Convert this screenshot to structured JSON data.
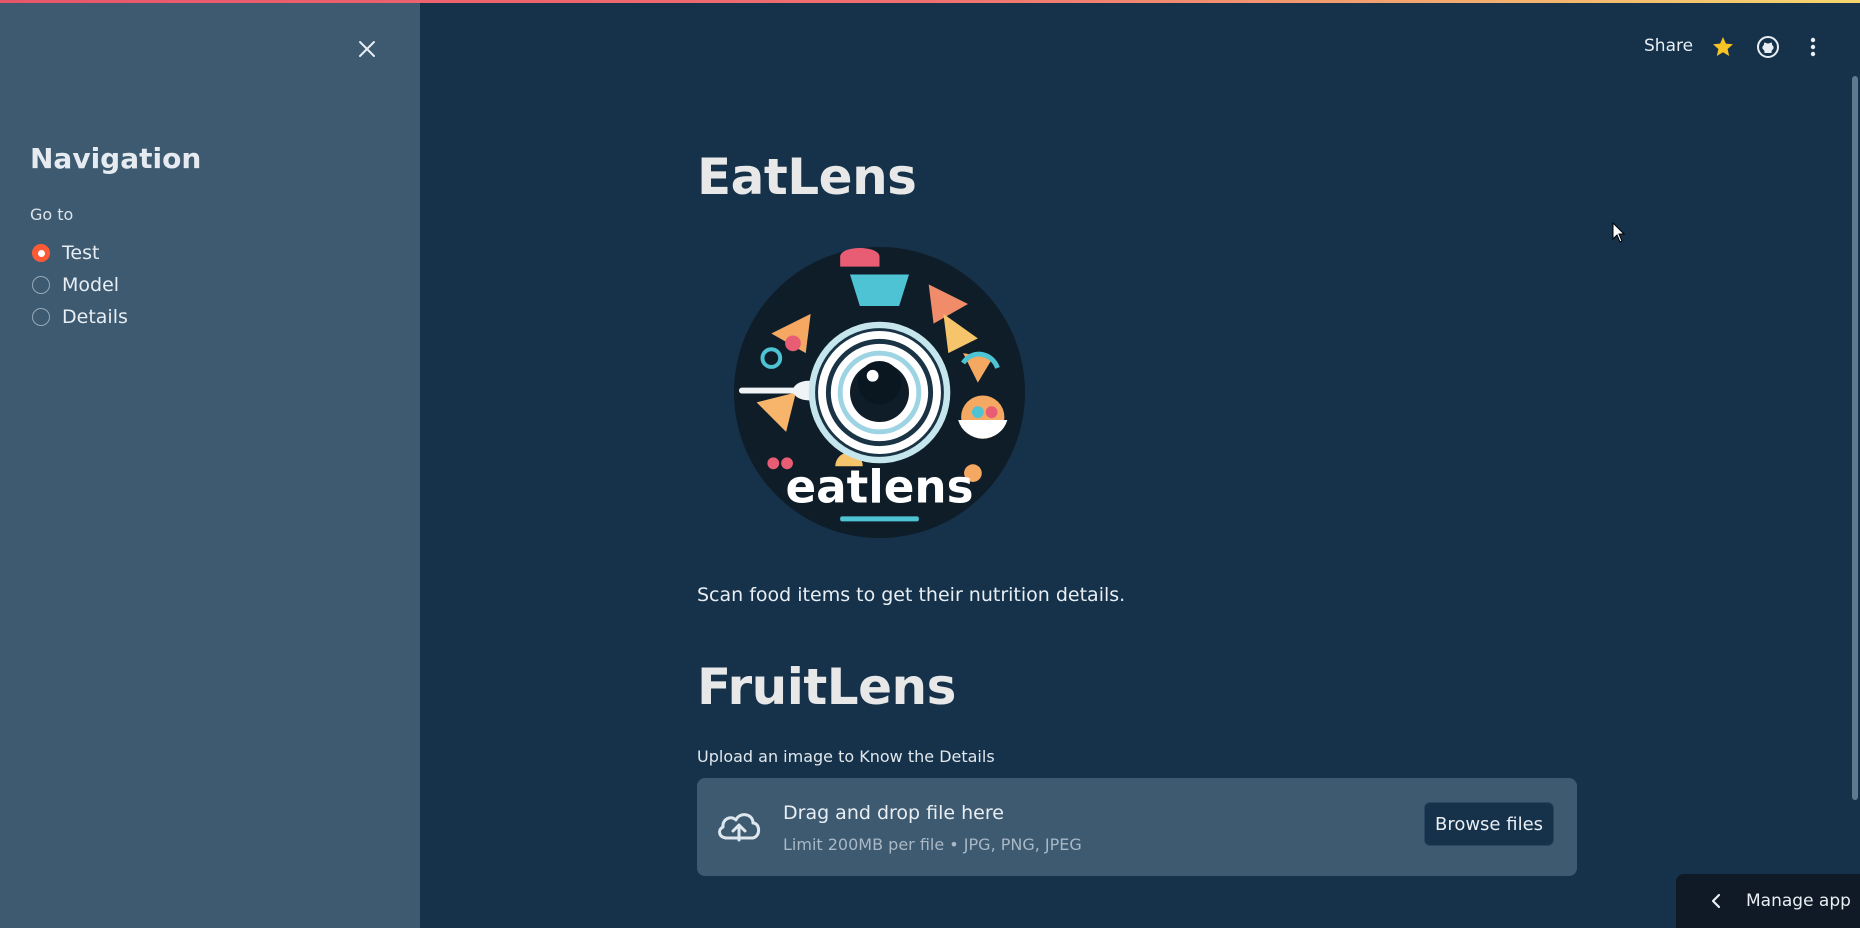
{
  "sidebar": {
    "title": "Navigation",
    "radio_label": "Go to",
    "options": [
      {
        "label": "Test",
        "checked": true
      },
      {
        "label": "Model",
        "checked": false
      },
      {
        "label": "Details",
        "checked": false
      }
    ]
  },
  "header": {
    "share_label": "Share",
    "icons": [
      "star-icon",
      "github-icon",
      "more-vertical-icon"
    ]
  },
  "main": {
    "title": "EatLens",
    "logo_text": "eatlens",
    "caption": "Scan food items to get their nutrition details.",
    "section_title": "FruitLens",
    "uploader": {
      "label": "Upload an image to Know the Details",
      "drop_text": "Drag and drop file here",
      "limit_text": "Limit 200MB per file • JPG, PNG, JPEG",
      "button_label": "Browse files"
    }
  },
  "footer": {
    "manage_label": "Manage app"
  },
  "colors": {
    "background": "#15324a",
    "sidebar": "#3d5a71",
    "accent": "#ff5a36",
    "star": "#f7c325"
  }
}
